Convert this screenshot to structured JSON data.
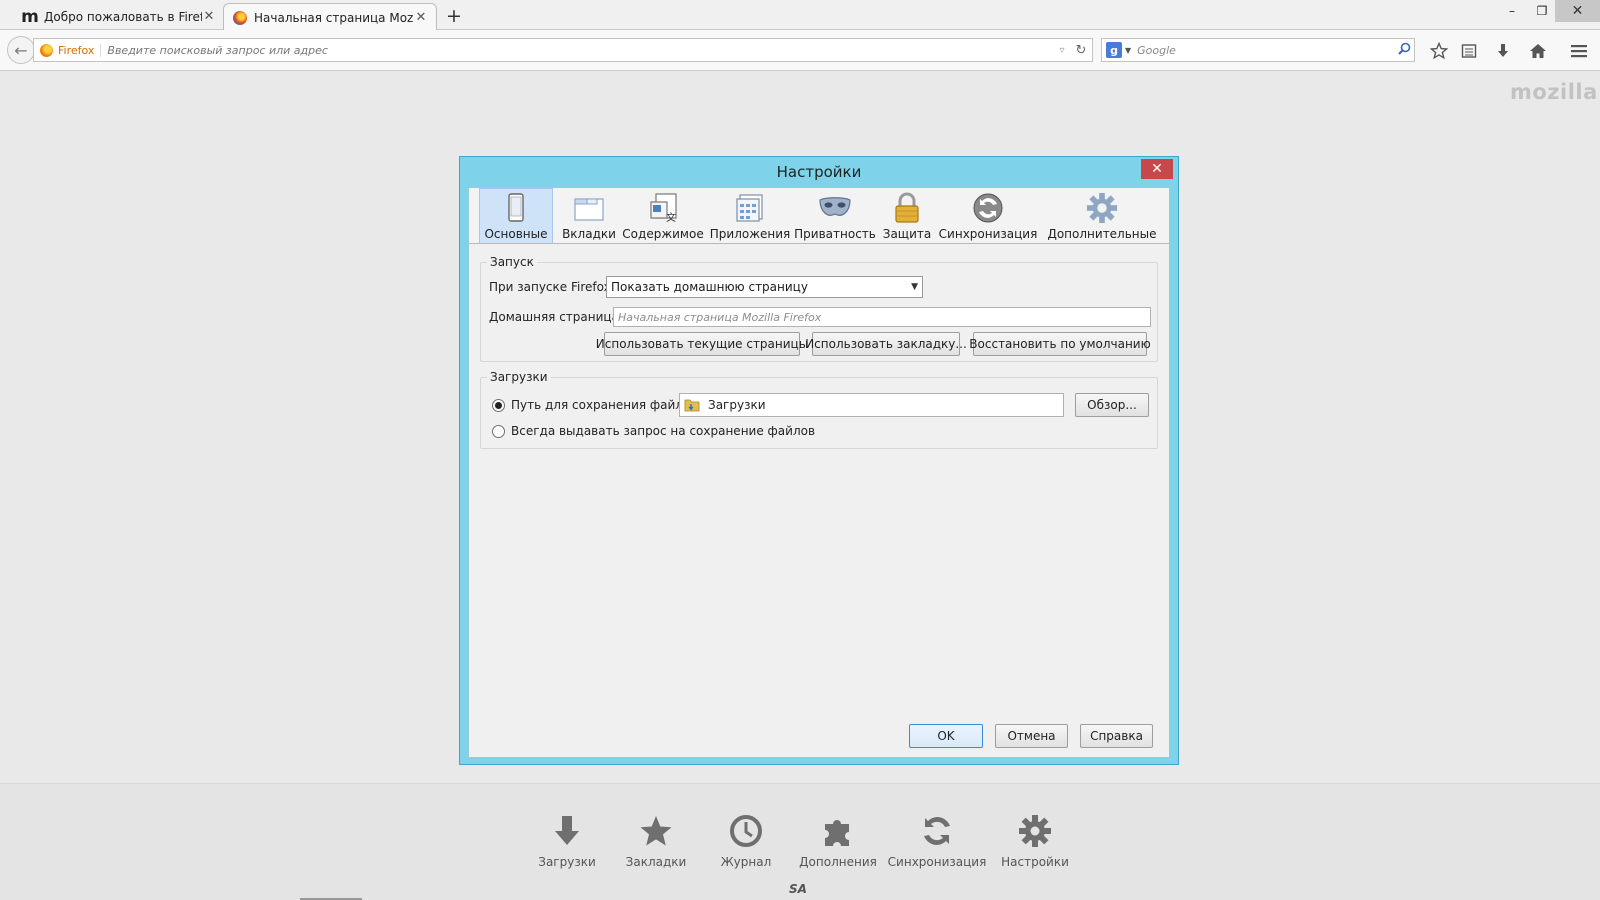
{
  "browser": {
    "tabs": [
      {
        "title": "Добро пожаловать в Firefox",
        "close": "✕"
      },
      {
        "title": "Начальная страница Mozi...",
        "close": "✕"
      }
    ],
    "new_tab": "+",
    "window": {
      "minimize": "–",
      "maximize": "❐",
      "close": "✕"
    },
    "url": {
      "identity_label": "Firefox",
      "placeholder": "Введите поисковый запрос или адрес"
    },
    "search": {
      "engine_letter": "g",
      "placeholder": "Google"
    }
  },
  "page": {
    "brand": "mozilla",
    "launcher": [
      {
        "label": "Загрузки",
        "icon": "download-icon"
      },
      {
        "label": "Закладки",
        "icon": "star-icon"
      },
      {
        "label": "Журнал",
        "icon": "clock-icon"
      },
      {
        "label": "Дополнения",
        "icon": "puzzle-icon"
      },
      {
        "label": "Синхронизация",
        "icon": "sync-icon"
      },
      {
        "label": "Настройки",
        "icon": "gear-icon"
      }
    ],
    "footer_mark": "SA"
  },
  "dialog": {
    "title": "Настройки",
    "close": "✕",
    "panes": [
      {
        "label": "Основные",
        "icon": "general-icon",
        "selected": true
      },
      {
        "label": "Вкладки",
        "icon": "tabs-icon"
      },
      {
        "label": "Содержимое",
        "icon": "content-icon"
      },
      {
        "label": "Приложения",
        "icon": "applications-icon"
      },
      {
        "label": "Приватность",
        "icon": "privacy-mask-icon"
      },
      {
        "label": "Защита",
        "icon": "padlock-icon"
      },
      {
        "label": "Синхронизация",
        "icon": "sync-icon"
      },
      {
        "label": "Дополнительные",
        "icon": "gear-icon"
      }
    ],
    "startup": {
      "legend": "Запуск",
      "on_start_label": "При запуске Firefox:",
      "on_start_value": "Показать домашнюю страницу",
      "home_label": "Домашняя страница:",
      "home_placeholder": "Начальная страница Mozilla Firefox",
      "btn_current": "Использовать текущие страницы",
      "btn_bookmark": "Использовать закладку...",
      "btn_default": "Восстановить по умолчанию"
    },
    "downloads": {
      "legend": "Загрузки",
      "save_path_label": "Путь для сохранения файлов",
      "save_path_value": "Загрузки",
      "browse": "Обзор...",
      "always_ask_label": "Всегда выдавать запрос на сохранение файлов",
      "selected_option": "save_path"
    },
    "buttons": {
      "ok": "OK",
      "cancel": "Отмена",
      "help": "Справка"
    }
  }
}
